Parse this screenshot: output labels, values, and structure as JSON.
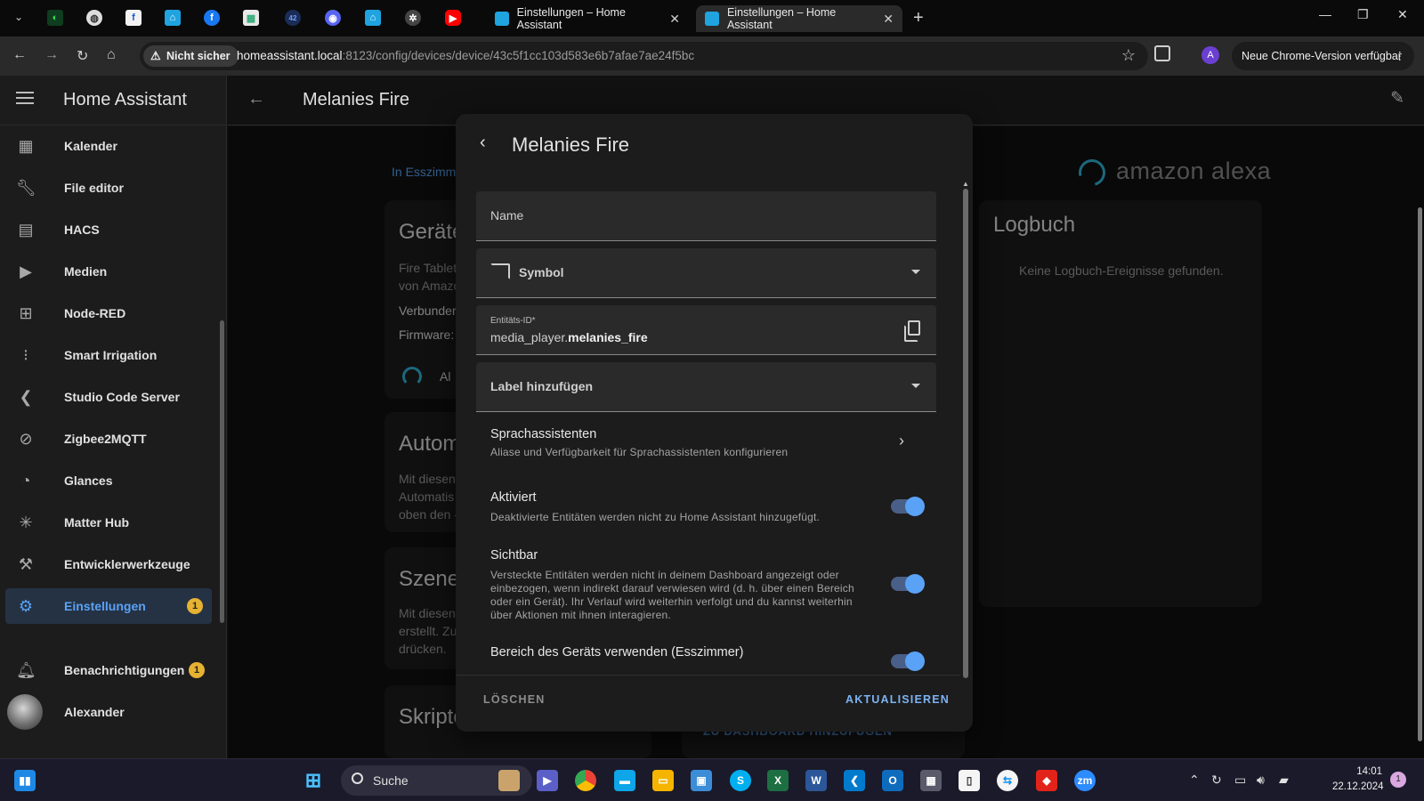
{
  "browser": {
    "tabs": [
      {
        "label": "Einstellungen – Home Assistant",
        "active": false
      },
      {
        "label": "Einstellungen – Home Assistant",
        "active": true
      }
    ],
    "address": {
      "security_label": "Nicht sicher",
      "host": "homeassistant.local",
      "path": ":8123/config/devices/device/43c5f1cc103d583e6b7afae7ae24f5bc"
    },
    "profile_initial": "A",
    "update_chip": "Neue Chrome-Version verfügbar",
    "pinned_letter_f": "f",
    "pinned_letter_fb": "f",
    "pinned_42": "42"
  },
  "sidebar": {
    "title": "Home Assistant",
    "items": [
      {
        "label": "Kalender",
        "icon": "calendar-icon"
      },
      {
        "label": "File editor",
        "icon": "wrench-icon"
      },
      {
        "label": "HACS",
        "icon": "hacs-icon"
      },
      {
        "label": "Medien",
        "icon": "media-icon"
      },
      {
        "label": "Node-RED",
        "icon": "sitemap-icon"
      },
      {
        "label": "Smart Irrigation",
        "icon": "sprinkler-icon"
      },
      {
        "label": "Studio Code Server",
        "icon": "vscode-icon"
      },
      {
        "label": "Zigbee2MQTT",
        "icon": "zigbee-icon"
      },
      {
        "label": "Glances",
        "icon": "gauge-icon"
      },
      {
        "label": "Matter Hub",
        "icon": "hub-icon"
      },
      {
        "label": "Entwicklerwerkzeuge",
        "icon": "hammer-icon"
      },
      {
        "label": "Einstellungen",
        "icon": "gear-icon",
        "badge": "1",
        "selected": true
      }
    ],
    "notifications": {
      "label": "Benachrichtigungen",
      "badge": "1"
    },
    "user": {
      "label": "Alexander"
    }
  },
  "page": {
    "title": "Melanies Fire",
    "breadcrumb": "In Esszimm",
    "device_card": {
      "title": "Geräte",
      "line1": "Fire Tablet",
      "line2": "von Amazo",
      "connected": "Verbunder",
      "firmware": "Firmware:",
      "integration": "Al"
    },
    "automation_card": {
      "title": "Autom",
      "l1": "Mit diesen",
      "l2": "Automatis",
      "l3": "oben den -"
    },
    "scenes_card": {
      "title": "Szene",
      "l1": "Mit diesen",
      "l2": "erstellt. Zu",
      "l3": "drücken."
    },
    "scripts_card": {
      "title": "Skripte"
    },
    "brand": "amazon alexa",
    "logbook": {
      "title": "Logbuch",
      "empty": "Keine Logbuch-Ereignisse gefunden."
    },
    "add_to_dashboard": "ZU DASHBOARD HINZUFÜGEN"
  },
  "dialog": {
    "title": "Melanies Fire",
    "name_field": {
      "label": "Name"
    },
    "symbol_field": {
      "label": "Symbol"
    },
    "entity_id_field": {
      "label": "Entitäts-ID*",
      "prefix": "media_player.",
      "value": "melanies_fire"
    },
    "label_field": {
      "label": "Label hinzufügen"
    },
    "voice": {
      "title": "Sprachassistenten",
      "desc": "Aliase und Verfügbarkeit für Sprachassistenten konfigurieren"
    },
    "enabled": {
      "title": "Aktiviert",
      "desc": "Deaktivierte Entitäten werden nicht zu Home Assistant hinzugefügt.",
      "on": true
    },
    "visible": {
      "title": "Sichtbar",
      "desc": "Versteckte Entitäten werden nicht in deinem Dashboard angezeigt oder einbezogen, wenn indirekt darauf verwiesen wird (d. h. über einen Bereich oder ein Gerät). Ihr Verlauf wird weiterhin verfolgt und du kannst weiterhin über Aktionen mit ihnen interagieren.",
      "on": true
    },
    "use_area": {
      "title": "Bereich des Geräts verwenden (Esszimmer)",
      "on": true
    },
    "delete_label": "LÖSCHEN",
    "update_label": "AKTUALISIEREN"
  },
  "taskbar": {
    "search_label": "Suche",
    "time": "14:01",
    "date": "22.12.2024",
    "notification_count": "1",
    "chrome_profile_letter": "A",
    "zoom_label": "zm"
  },
  "colors": {
    "accent": "#5aa2f5",
    "badge": "#e6b232",
    "background": "#111111",
    "card": "#1c1c1c"
  }
}
